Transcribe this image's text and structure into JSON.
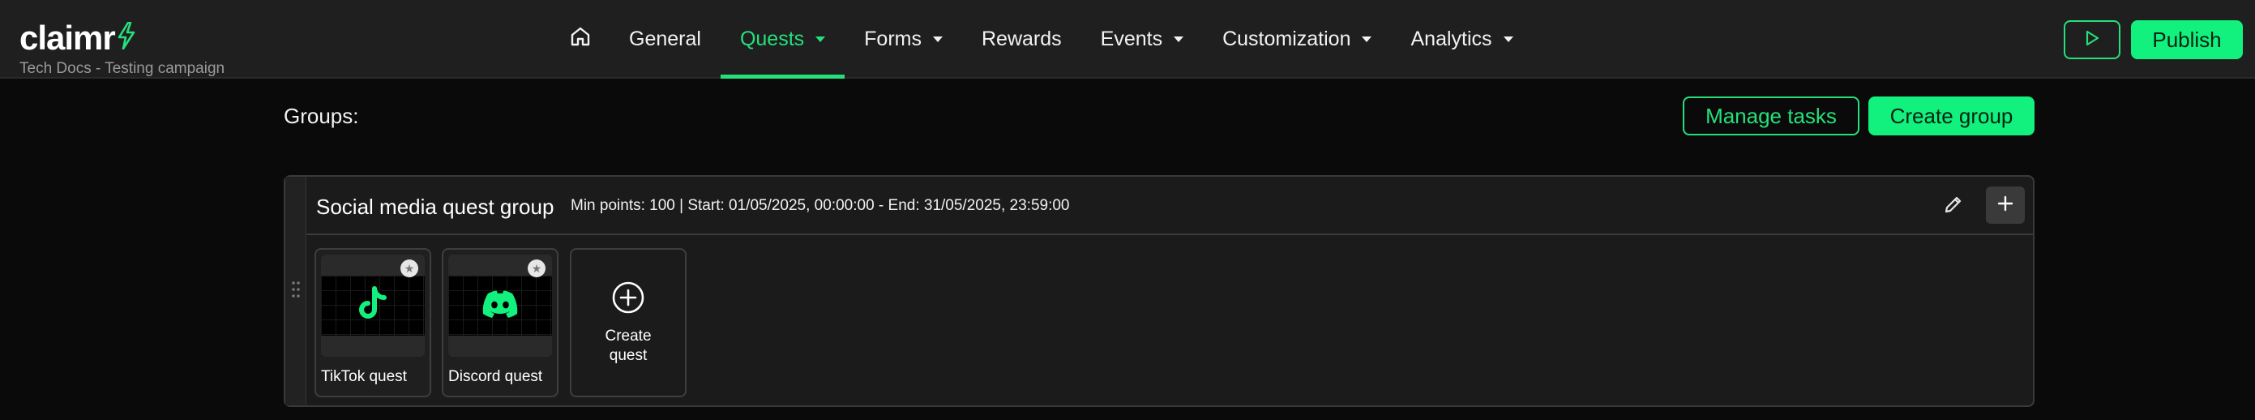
{
  "brand": {
    "name": "claimr",
    "subtitle": "Tech Docs - Testing campaign",
    "accent": "#25e07a"
  },
  "nav": {
    "items": [
      {
        "label": "General",
        "dropdown": false,
        "active": false
      },
      {
        "label": "Quests",
        "dropdown": true,
        "active": true
      },
      {
        "label": "Forms",
        "dropdown": true,
        "active": false
      },
      {
        "label": "Rewards",
        "dropdown": false,
        "active": false
      },
      {
        "label": "Events",
        "dropdown": true,
        "active": false
      },
      {
        "label": "Customization",
        "dropdown": true,
        "active": false
      },
      {
        "label": "Analytics",
        "dropdown": true,
        "active": false
      }
    ]
  },
  "actions": {
    "publish_label": "Publish"
  },
  "main": {
    "groups_label": "Groups:",
    "manage_tasks_label": "Manage tasks",
    "create_group_label": "Create group"
  },
  "group": {
    "title": "Social media quest group",
    "meta": "Min points: 100 | Start: 01/05/2025, 00:00:00 - End: 31/05/2025, 23:59:00",
    "quests": [
      {
        "label": "TikTok quest",
        "icon": "tiktok-icon"
      },
      {
        "label": "Discord quest",
        "icon": "discord-icon"
      }
    ],
    "create_quest_label": "Create quest"
  }
}
